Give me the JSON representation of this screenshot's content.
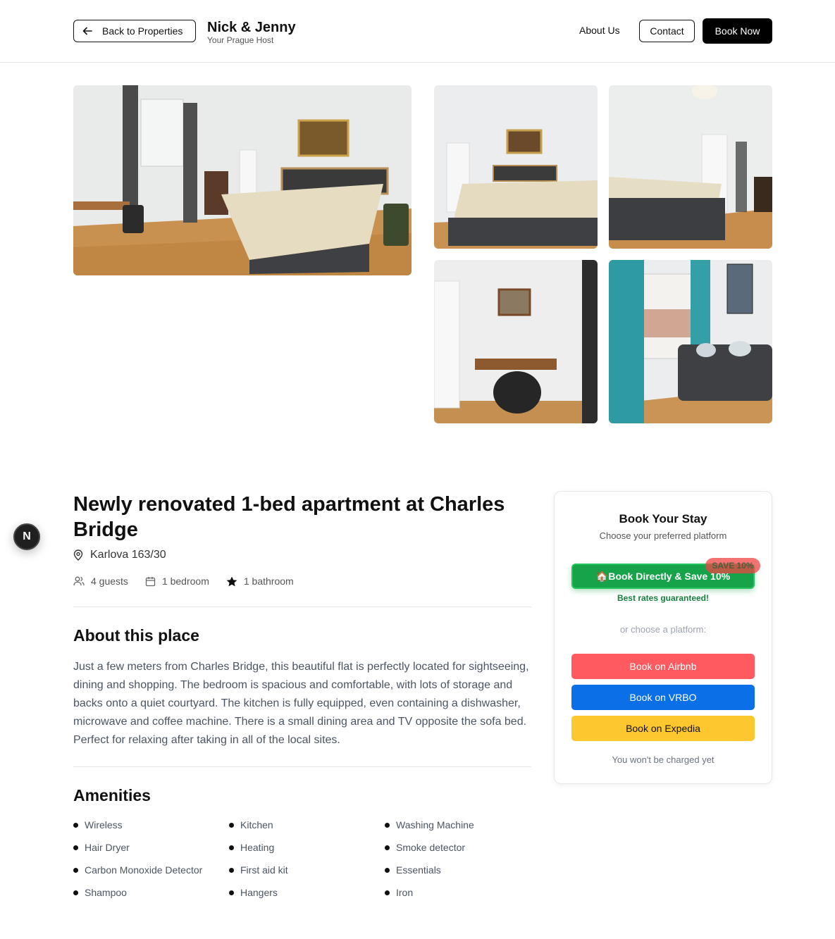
{
  "header": {
    "back_label": "Back to Properties",
    "brand_name": "Nick & Jenny",
    "brand_sub": "Your Prague Host",
    "nav_about": "About Us",
    "nav_contact": "Contact",
    "nav_book": "Book Now"
  },
  "badge": {
    "letter": "N"
  },
  "listing": {
    "title": "Newly renovated 1-bed apartment at Charles Bridge",
    "address": "Karlova 163/30",
    "stats": {
      "guests": "4 guests",
      "bedrooms": "1 bedroom",
      "bathrooms": "1 bathroom"
    }
  },
  "about": {
    "heading": "About this place",
    "text": "Just a few meters from Charles Bridge, this beautiful flat is perfectly located for sightseeing, dining and shopping. The bedroom is spacious and comfortable, with lots of storage and backs onto a quiet courtyard. The kitchen is fully equipped, even containing a dishwasher, microwave and coffee machine. There is a small dining area and TV opposite the sofa bed. Perfect for relaxing after taking in all of the local sites."
  },
  "amenities": {
    "heading": "Amenities",
    "items": [
      "Wireless",
      "Kitchen",
      "Washing Machine",
      "Hair Dryer",
      "Heating",
      "Smoke detector",
      "Carbon Monoxide Detector",
      "First aid kit",
      "Essentials",
      "Shampoo",
      "Hangers",
      "Iron"
    ]
  },
  "booking": {
    "title": "Book Your Stay",
    "subtitle": "Choose your preferred platform",
    "direct_label": "🏠Book Directly & Save 10%",
    "save_badge": "SAVE 10%",
    "best_rates": "Best rates guaranteed!",
    "or_choose": "or choose a platform:",
    "airbnb_label": "Book on Airbnb",
    "vrbo_label": "Book on VRBO",
    "expedia_label": "Book on Expedia",
    "note": "You won't be charged yet"
  },
  "colors": {
    "primary": "#000000",
    "direct_green": "#16a34a",
    "save_red": "#ef4444",
    "airbnb": "#ff5a5f",
    "vrbo": "#0b6fe8",
    "expedia": "#fdc72f"
  },
  "icons": {
    "back": "arrow-left-icon",
    "location": "map-pin-icon",
    "guests": "users-icon",
    "bedroom": "calendar-icon",
    "bathroom": "star-icon"
  }
}
